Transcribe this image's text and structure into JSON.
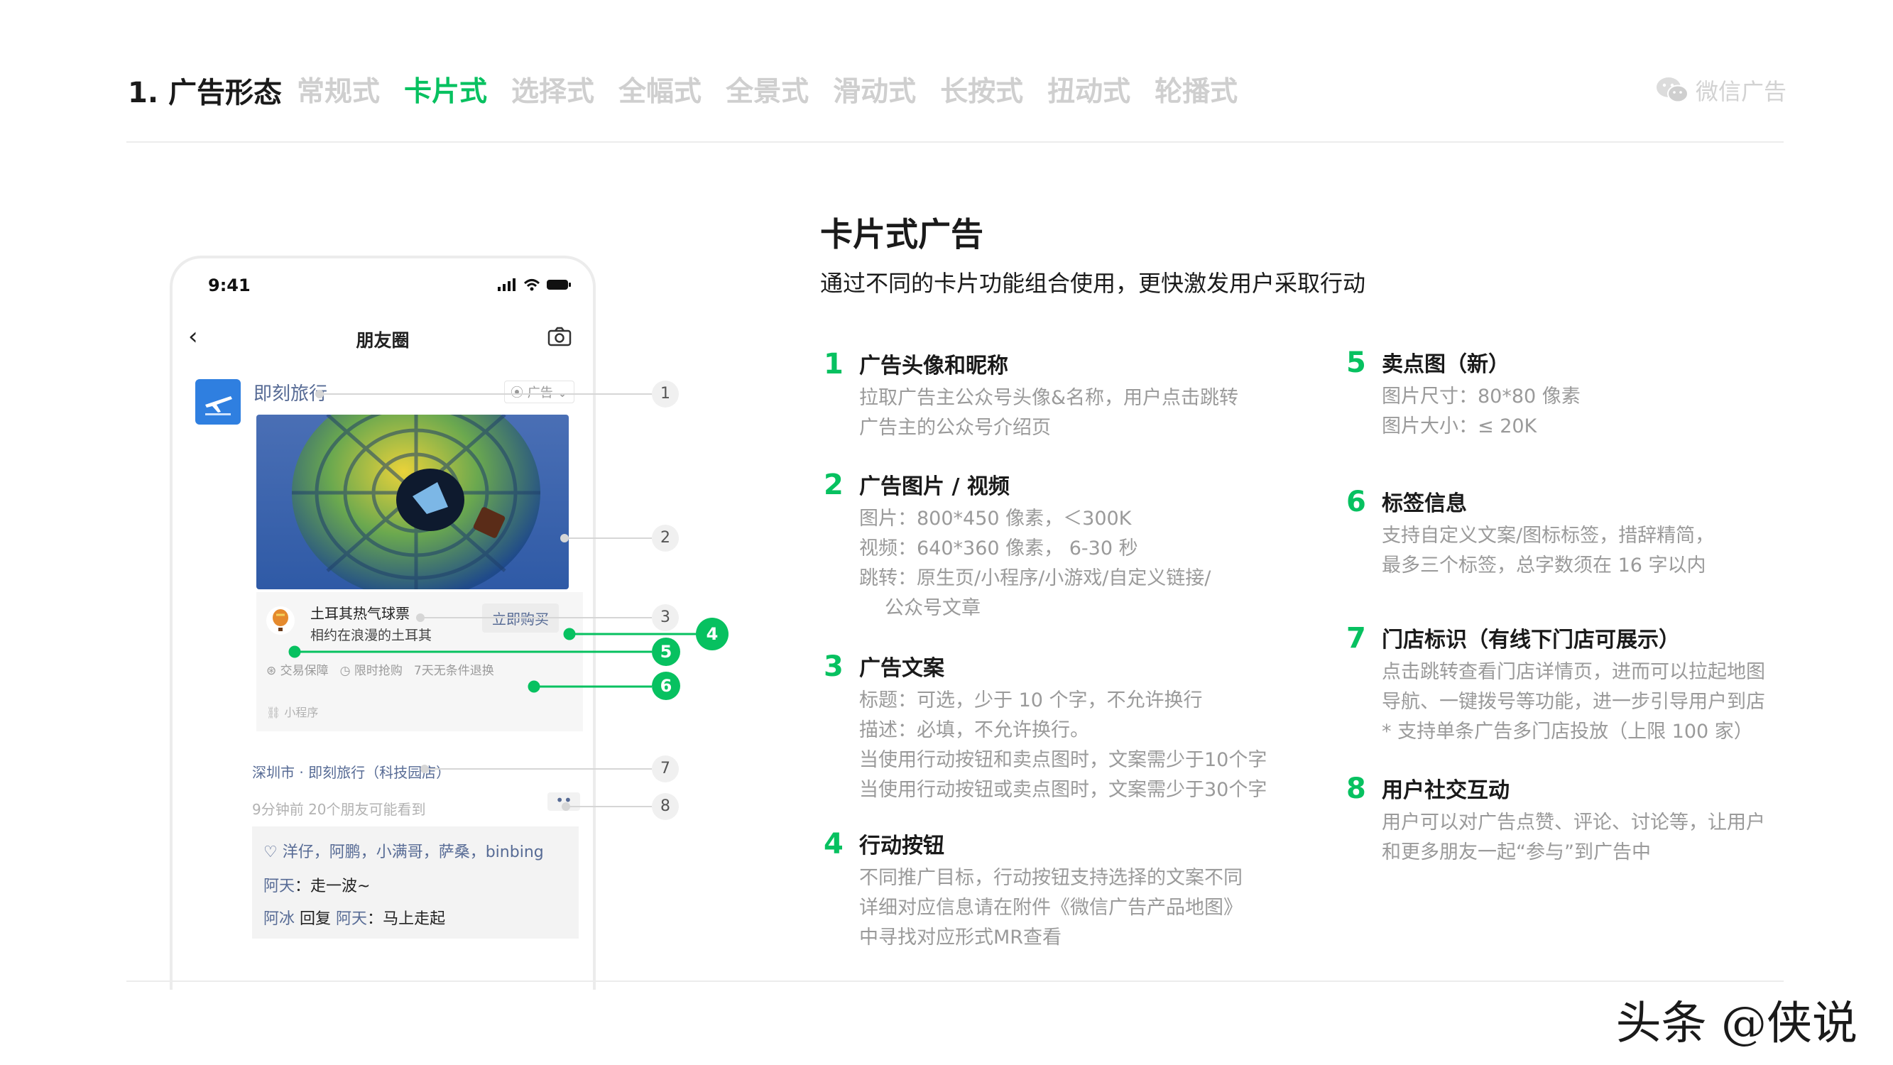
{
  "header": {
    "title": "1. 广告形态",
    "tabs": [
      {
        "label": "常规式",
        "active": false
      },
      {
        "label": "卡片式",
        "active": true
      },
      {
        "label": "选择式",
        "active": false
      },
      {
        "label": "全幅式",
        "active": false
      },
      {
        "label": "全景式",
        "active": false
      },
      {
        "label": "滑动式",
        "active": false
      },
      {
        "label": "长按式",
        "active": false
      },
      {
        "label": "扭动式",
        "active": false
      },
      {
        "label": "轮播式",
        "active": false
      }
    ],
    "brand": "微信广告",
    "accent_color": "#07c160"
  },
  "phone": {
    "time": "9:41",
    "nav_title": "朋友圈",
    "advertiser": "即刻旅行",
    "ad_tag": "广告",
    "card": {
      "title": "土耳其热气球票",
      "desc": "相约在浪漫的土耳其",
      "button": "立即购买",
      "tags": [
        "交易保障",
        "限时抢购",
        "7天无条件退换"
      ],
      "mini_program": "小程序"
    },
    "location": "深圳市 · 即刻旅行（科技园店）",
    "post_time": "9分钟前  20个朋友可能看到",
    "likes": "洋仔，阿鹏，小满哥，萨桑，binbing",
    "comments": [
      {
        "name": "阿天",
        "text": "走一波~"
      },
      {
        "name": "阿冰",
        "reply": "回复",
        "to": "阿天",
        "text": "马上走起"
      }
    ]
  },
  "callouts": [
    "1",
    "2",
    "3",
    "4",
    "5",
    "6",
    "7",
    "8"
  ],
  "right": {
    "title": "卡片式广告",
    "subtitle": "通过不同的卡片功能组合使用，更快激发用户采取行动",
    "features": [
      {
        "num": "1",
        "title": "广告头像和昵称",
        "lines": [
          "拉取广告主公众号头像&名称，用户点击跳转",
          "广告主的公众号介绍页"
        ]
      },
      {
        "num": "2",
        "title": "广告图片 / 视频",
        "lines": [
          "图片：800*450 像素，＜300K",
          "视频：640*360 像素，  6-30 秒",
          "跳转：原生页/小程序/小游戏/自定义链接/",
          "      公众号文章"
        ]
      },
      {
        "num": "3",
        "title": "广告文案",
        "lines": [
          "标题：可选，少于 10 个字，不允许换行",
          "描述：必填，不允许换行。",
          "当使用行动按钮和卖点图时，文案需少于10个字",
          "当使用行动按钮或卖点图时，文案需少于30个字"
        ]
      },
      {
        "num": "4",
        "title": "行动按钮",
        "lines": [
          "不同推广目标，行动按钮支持选择的文案不同",
          "详细对应信息请在附件《微信广告产品地图》",
          "中寻找对应形式MR查看"
        ]
      },
      {
        "num": "5",
        "title": "卖点图（新）",
        "lines": [
          "图片尺寸：80*80 像素",
          "图片大小：≤ 20K"
        ]
      },
      {
        "num": "6",
        "title": "标签信息",
        "lines": [
          "支持自定义文案/图标标签，措辞精简，",
          "最多三个标签，总字数须在 16 字以内"
        ]
      },
      {
        "num": "7",
        "title": "门店标识（有线下门店可展示）",
        "lines": [
          "点击跳转查看门店详情页，进而可以拉起地图",
          "导航、一键拨号等功能，进一步引导用户到店",
          "* 支持单条广告多门店投放（上限 100 家）"
        ]
      },
      {
        "num": "8",
        "title": "用户社交互动",
        "lines": [
          "用户可以对广告点赞、评论、讨论等，让用户",
          "和更多朋友一起“参与”到广告中"
        ]
      }
    ]
  },
  "watermark": "头条 @侠说"
}
